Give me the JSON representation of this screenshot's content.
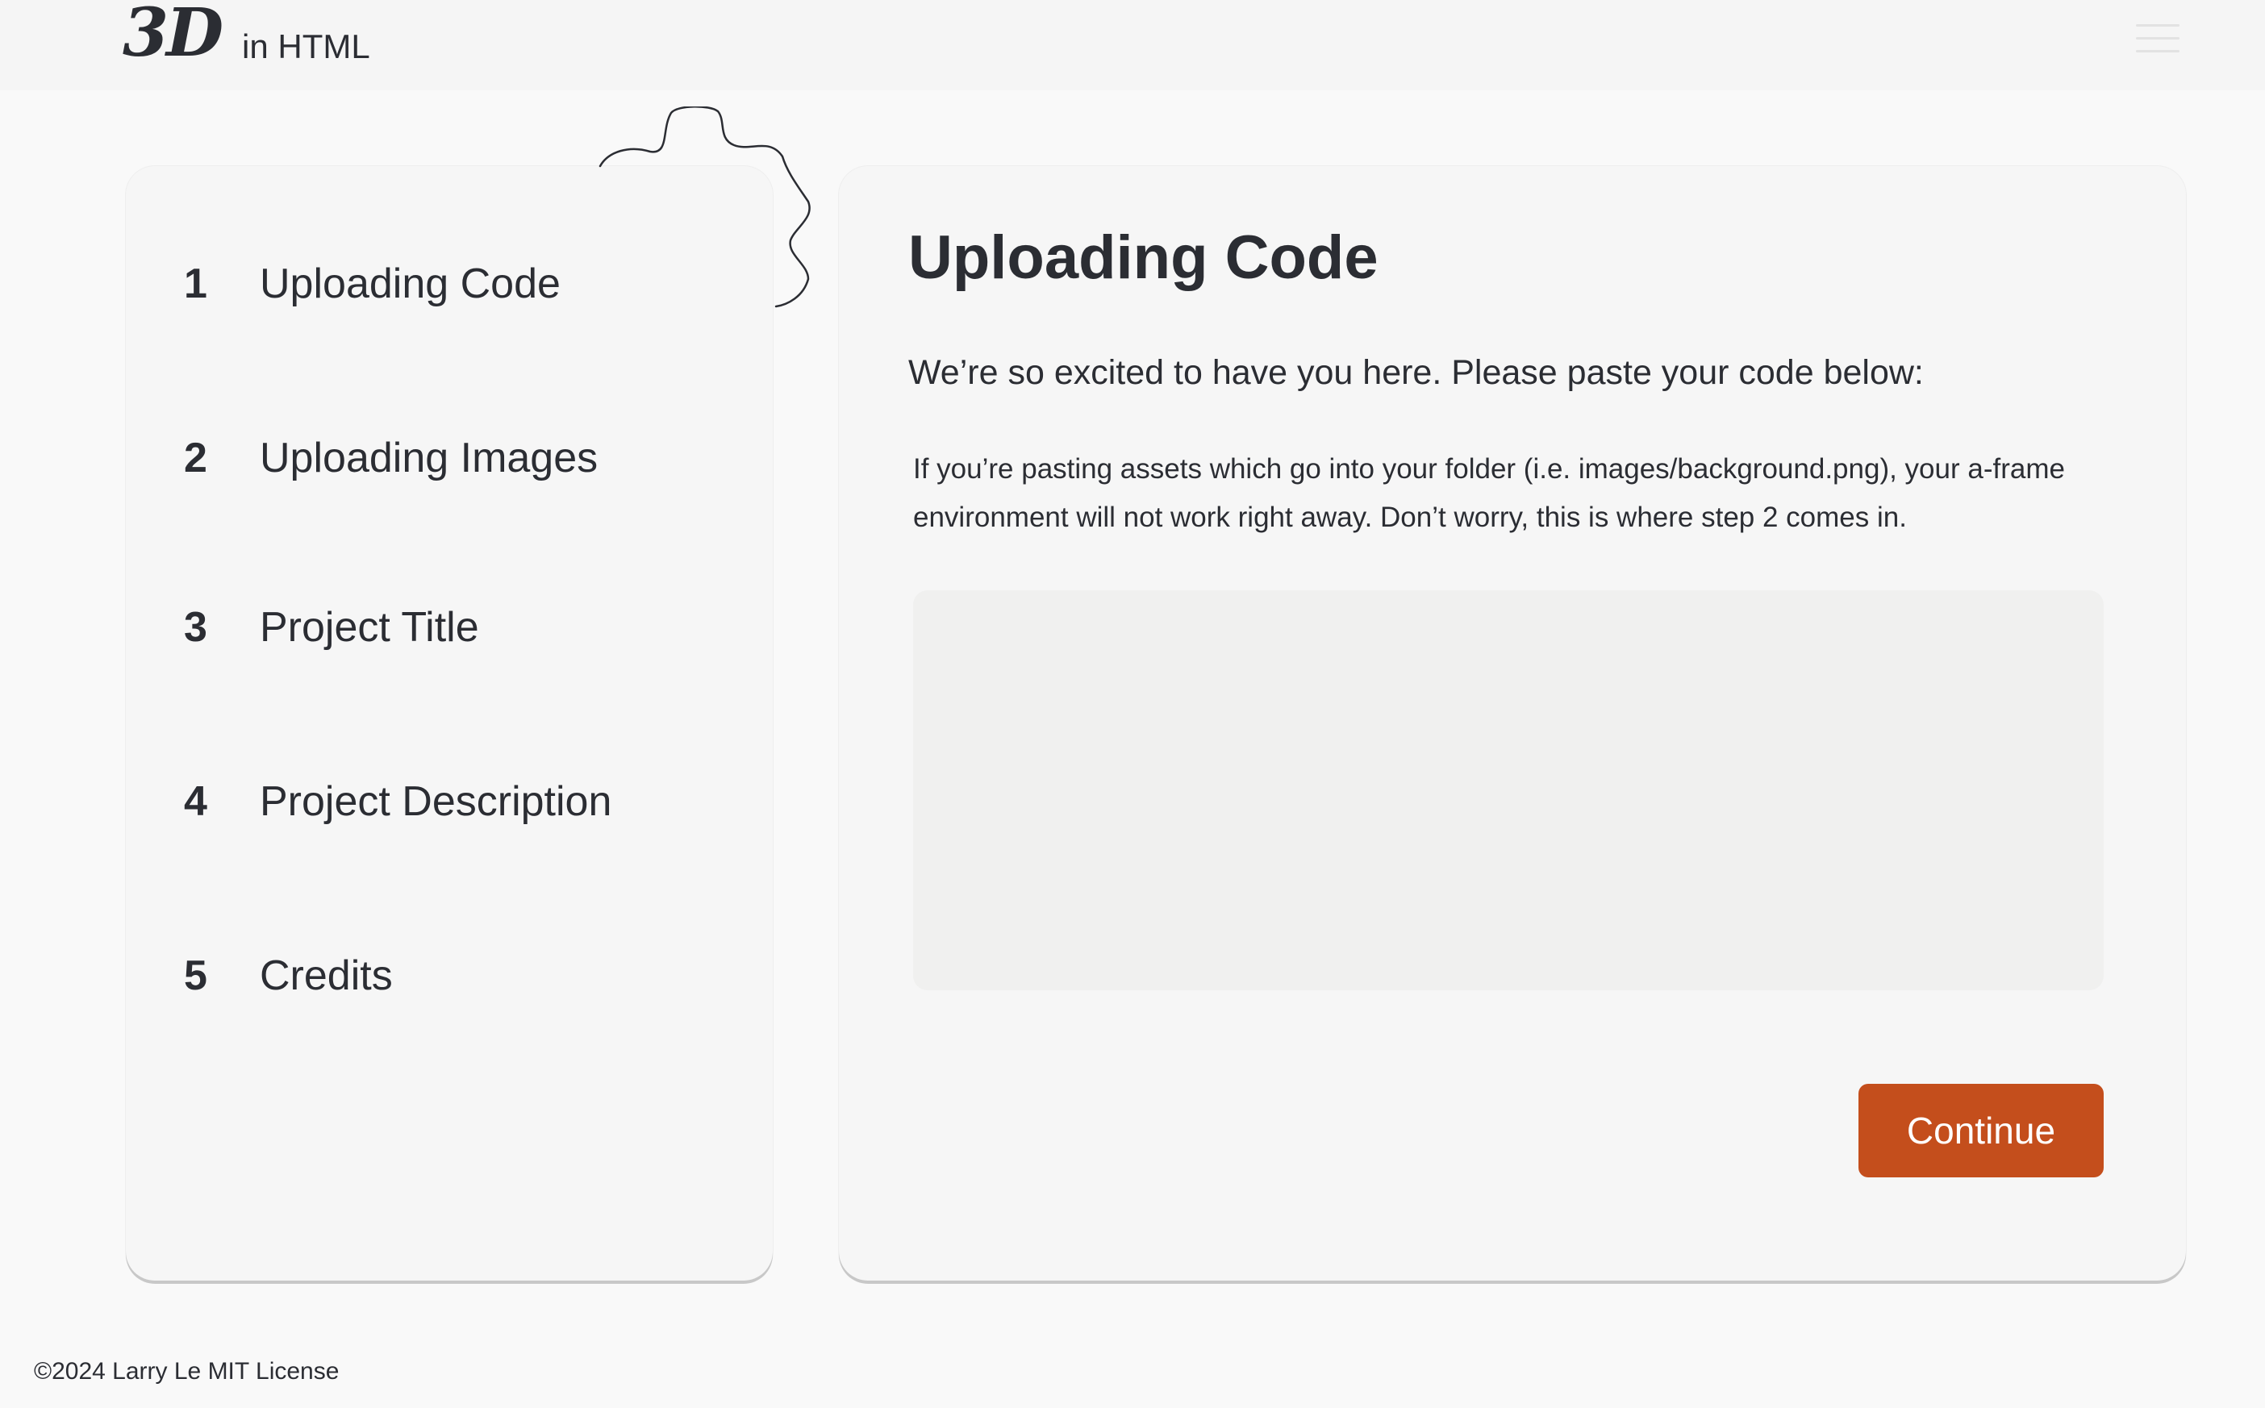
{
  "header": {
    "logo_text": "3D",
    "logo_sub": "in HTML",
    "menu_icon": "hamburger-menu-icon"
  },
  "steps": [
    {
      "number": "1",
      "label": "Uploading Code"
    },
    {
      "number": "2",
      "label": "Uploading Images"
    },
    {
      "number": "3",
      "label": "Project Title"
    },
    {
      "number": "4",
      "label": "Project Description"
    },
    {
      "number": "5",
      "label": "Credits"
    }
  ],
  "main": {
    "title": "Uploading Code",
    "intro": "We’re so excited to have you here. Please paste your code below:",
    "note": "If you’re pasting assets which go into your folder (i.e. images/background.png), your a-frame environment will not work right away. Don’t worry, this is where step 2 comes in.",
    "code_value": "",
    "code_placeholder": "",
    "continue_label": "Continue"
  },
  "footer": {
    "text": "©2024 Larry Le MIT License"
  },
  "colors": {
    "accent": "#c44e1c",
    "text": "#2b2d33",
    "background": "#f9f9f9",
    "card": "#f6f6f6"
  }
}
